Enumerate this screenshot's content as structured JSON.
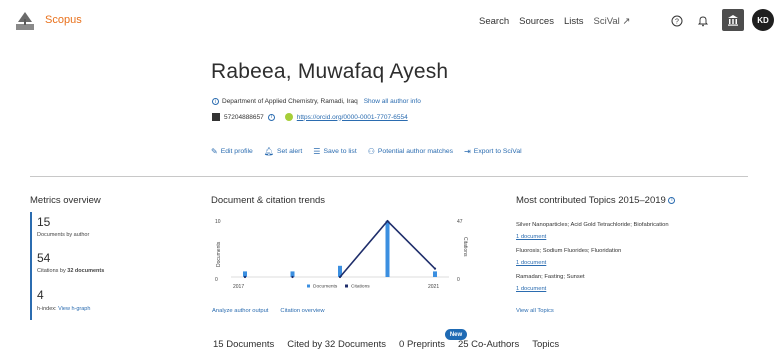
{
  "header": {
    "brand": "Scopus",
    "nav": [
      "Search",
      "Sources",
      "Lists",
      "SciVal ↗"
    ],
    "avatar_initials": "KD"
  },
  "author": {
    "name": "Rabeea, Muwafaq Ayesh",
    "affiliation": "Department of Applied Chemistry, Ramadi, Iraq",
    "show_all_info": "Show all author info",
    "author_id": "57204888657",
    "orcid_url": "https://orcid.org/0000-0001-7707-6554"
  },
  "actions": [
    "Edit profile",
    "Set alert",
    "Save to list",
    "Potential author matches",
    "Export to SciVal"
  ],
  "metrics": {
    "title": "Metrics overview",
    "documents_value": "15",
    "documents_label": "Documents by author",
    "citations_value": "54",
    "citations_label_prefix": "Citations by",
    "citations_label_bold": "32 documents",
    "hindex_value": "4",
    "hindex_label": "h-index:",
    "hindex_link": "View h-graph"
  },
  "trends": {
    "title": "Document & citation trends",
    "left_axis_label": "Documents",
    "right_axis_label": "Citations",
    "left_top_tick": "10",
    "left_bottom_tick": "0",
    "right_top_tick": "47",
    "right_bottom_tick": "0",
    "x_start": "2017",
    "x_end": "2021",
    "legend_documents": "Documents",
    "legend_citations": "Citations",
    "analyze_link": "Analyze author output",
    "citation_overview_link": "Citation overview"
  },
  "chart_data": {
    "type": "bar",
    "categories": [
      "2017",
      "2018",
      "2019",
      "2020",
      "2021"
    ],
    "series": [
      {
        "name": "Documents",
        "values": [
          1,
          1,
          2,
          10,
          1
        ]
      },
      {
        "name": "Citations",
        "values": [
          0,
          0,
          0,
          47,
          7
        ]
      }
    ],
    "ylim_left": [
      0,
      10
    ],
    "ylim_right": [
      0,
      47
    ],
    "ylabel_left": "Documents",
    "ylabel_right": "Citations",
    "legend": "bottom"
  },
  "topics": {
    "title": "Most contributed Topics 2015–2019",
    "items": [
      {
        "name": "Silver Nanoparticles; Acid Gold Tetrachloride; Biofabrication",
        "docs": "1 document"
      },
      {
        "name": "Fluorosis; Sodium Fluorides; Fluoridation",
        "docs": "1 document"
      },
      {
        "name": "Ramadan; Fasting; Sunset",
        "docs": "1 document"
      }
    ],
    "view_all": "View all Topics"
  },
  "tabs": [
    "15 Documents",
    "Cited by 32 Documents",
    "0 Preprints",
    "25 Co-Authors",
    "Topics"
  ],
  "new_badge": "New",
  "colors": {
    "brand": "#e9711c",
    "link": "#2b6cb0",
    "documents_bar": "#3b8fe0",
    "citations_line": "#1f2e6b"
  }
}
